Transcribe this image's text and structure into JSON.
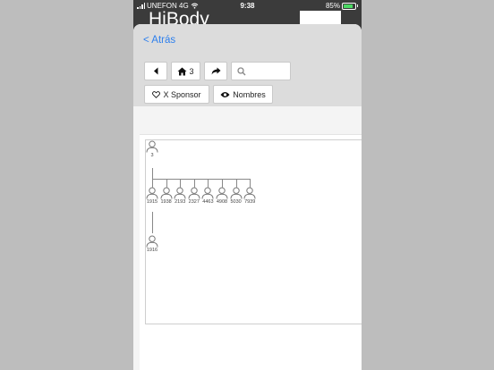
{
  "status_bar": {
    "carrier": "UNEFON 4G",
    "time": "9:38",
    "battery": "85%"
  },
  "app": {
    "title": "HiBody"
  },
  "nav": {
    "back_label": "< Atrás"
  },
  "toolbar": {
    "home_count": "3",
    "search_placeholder": "",
    "sponsor_label": "X Sponsor",
    "names_label": "Nombres"
  },
  "tree": {
    "root": {
      "id": "3"
    },
    "children": [
      {
        "id": "1915"
      },
      {
        "id": "1938"
      },
      {
        "id": "2193"
      },
      {
        "id": "2327"
      },
      {
        "id": "4463"
      },
      {
        "id": "4908"
      },
      {
        "id": "5030"
      },
      {
        "id": "7939"
      }
    ],
    "grandchild": {
      "id": "1916"
    }
  },
  "colors": {
    "link": "#2f80ed",
    "battery": "#4cd964"
  }
}
